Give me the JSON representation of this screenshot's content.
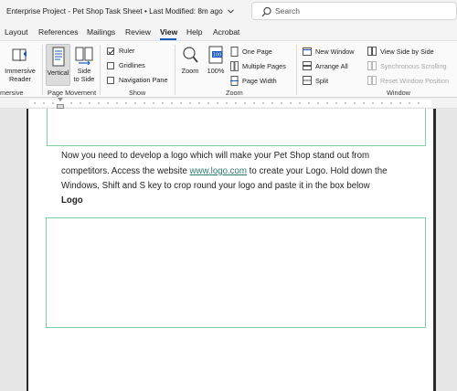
{
  "titlebar": {
    "document_title": "Enterprise Project - Pet Shop Task Sheet",
    "separator": "•",
    "modified": "Last Modified: 8m ago",
    "search_placeholder": "Search"
  },
  "tabs": [
    {
      "label": "Layout"
    },
    {
      "label": "References"
    },
    {
      "label": "Mailings"
    },
    {
      "label": "Review"
    },
    {
      "label": "View",
      "active": true
    },
    {
      "label": "Help"
    },
    {
      "label": "Acrobat"
    }
  ],
  "ribbon": {
    "immersive": {
      "group_label": "mersive",
      "reader_line1": "Immersive",
      "reader_line2": "Reader"
    },
    "page_movement": {
      "group_label": "Page Movement",
      "vertical": "Vertical",
      "side_line1": "Side",
      "side_line2": "to Side"
    },
    "show": {
      "group_label": "Show",
      "ruler": {
        "label": "Ruler",
        "checked": true
      },
      "gridlines": {
        "label": "Gridlines",
        "checked": false
      },
      "navigation": {
        "label": "Navigation Pane",
        "checked": false
      }
    },
    "zoom": {
      "group_label": "Zoom",
      "zoom": "Zoom",
      "hundred": "100%",
      "one_page": "One Page",
      "multiple_pages": "Multiple Pages",
      "page_width": "Page Width"
    },
    "window": {
      "group_label": "Window",
      "new_window": "New Window",
      "arrange_all": "Arrange All",
      "split": "Split",
      "side_by_side": "View Side by Side",
      "sync_scrolling": "Synchronous Scrolling",
      "reset_position": "Reset Window Position"
    }
  },
  "document": {
    "para_before_link": "Now you need to develop a logo which will make your Pet Shop stand out from competitors. Access the website ",
    "link_text": "www.logo.com",
    "para_after_link": " to create your Logo. Hold down the Windows, Shift and S key to crop round your logo and paste it in the box below",
    "logo_heading": "Logo"
  },
  "colors": {
    "accent": "#185abd",
    "box_border": "#7fd1a2",
    "link": "#2e7d6b"
  }
}
